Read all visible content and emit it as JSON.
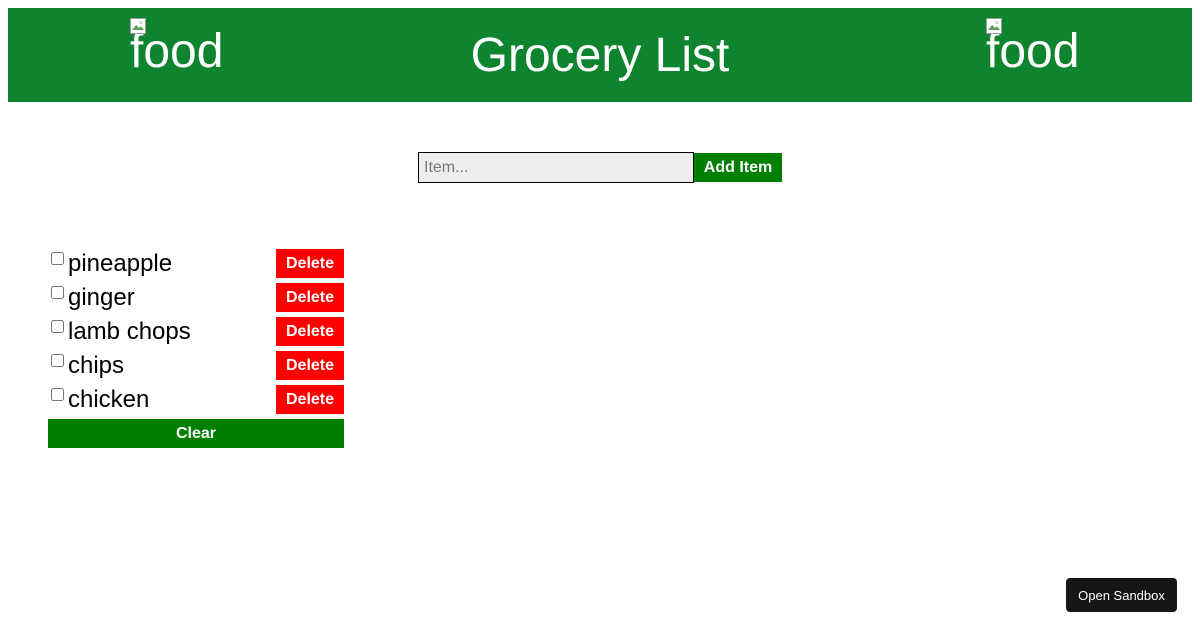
{
  "header": {
    "title": "Grocery List",
    "left_image_alt": "food",
    "right_image_alt": "food",
    "background_color": "#0e842f"
  },
  "add_form": {
    "placeholder": "Item...",
    "value": "",
    "add_label": "Add Item"
  },
  "items": [
    {
      "label": "pineapple",
      "checked": false,
      "delete_label": "Delete"
    },
    {
      "label": "ginger",
      "checked": false,
      "delete_label": "Delete"
    },
    {
      "label": "lamb chops",
      "checked": false,
      "delete_label": "Delete"
    },
    {
      "label": "chips",
      "checked": false,
      "delete_label": "Delete"
    },
    {
      "label": "chicken",
      "checked": false,
      "delete_label": "Delete"
    }
  ],
  "clear_label": "Clear",
  "sandbox_label": "Open Sandbox",
  "colors": {
    "accent_green": "#008000",
    "delete_red": "#ff0000"
  }
}
